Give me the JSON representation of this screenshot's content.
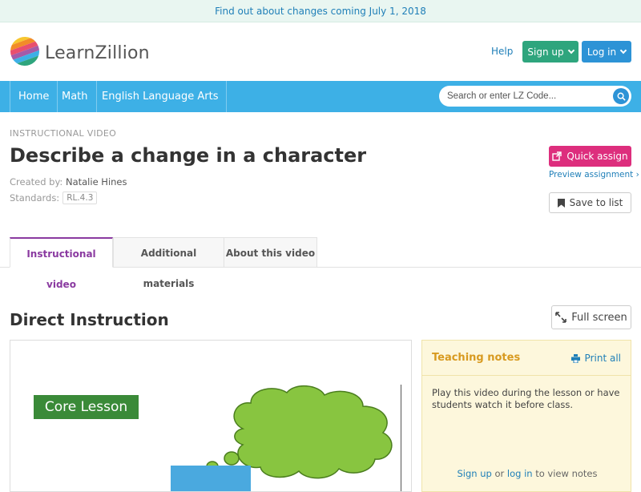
{
  "banner": {
    "text": "Find out about changes coming July 1, 2018"
  },
  "header": {
    "logo_text": "LearnZillion",
    "help": "Help",
    "signup": "Sign up",
    "login": "Log in"
  },
  "nav": {
    "items": [
      {
        "label": "Home"
      },
      {
        "label": "Math"
      },
      {
        "label": "English Language Arts"
      }
    ],
    "search_placeholder": "Search or enter LZ Code..."
  },
  "lesson": {
    "eyebrow": "Instructional Video",
    "title": "Describe a change in a character",
    "created_by_label": "Created by:",
    "author": "Natalie Hines",
    "standards_label": "Standards:",
    "standard": "RL.4.3"
  },
  "actions": {
    "quick_assign": "Quick assign",
    "preview": "Preview assignment ›",
    "save": "Save to list"
  },
  "tabs": [
    {
      "label": "Instructional video"
    },
    {
      "label": "Additional materials"
    },
    {
      "label": "About this video"
    }
  ],
  "section": {
    "title": "Direct Instruction",
    "full_screen": "Full screen"
  },
  "video": {
    "core_label": "Core Lesson"
  },
  "notes": {
    "title": "Teaching notes",
    "print": "Print all",
    "body": "Play this video during the lesson or have students watch it before class.",
    "foot_signup": "Sign up",
    "foot_or": "or",
    "foot_login": "log in",
    "foot_rest": "to view notes"
  },
  "colors": {
    "nav_blue": "#3db0e6",
    "signup_green": "#2ea57d",
    "login_blue": "#2d93d6",
    "quick_assign_pink": "#dd2e7d",
    "tab_active_purple": "#8a3aa0",
    "notes_title_orange": "#d89a20"
  }
}
